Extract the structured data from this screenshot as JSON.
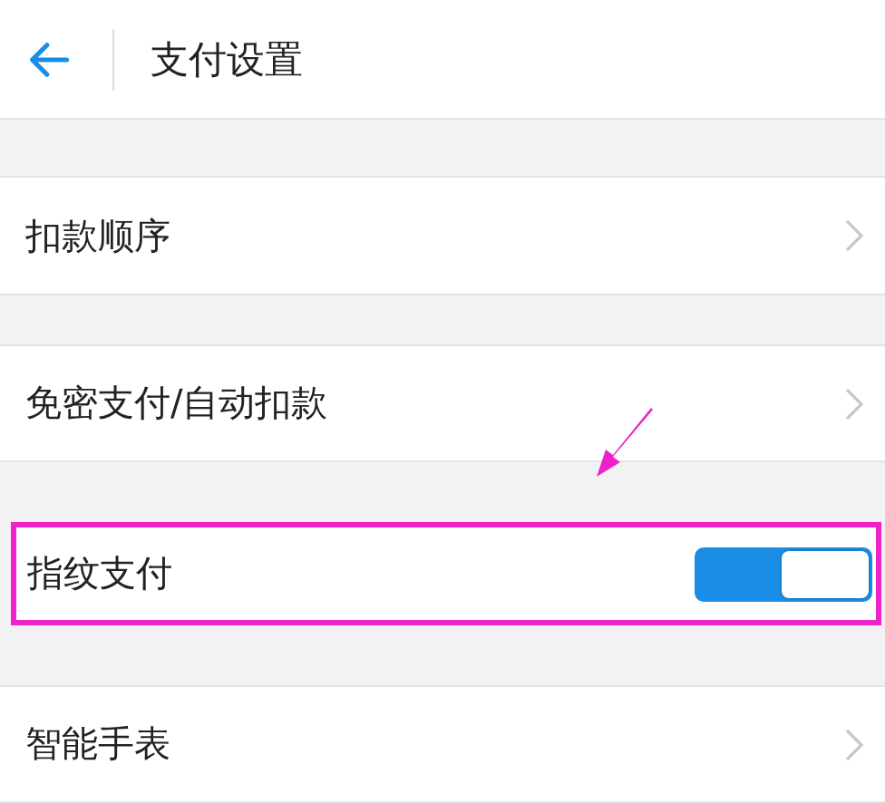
{
  "header": {
    "title": "支付设置"
  },
  "sections": [
    {
      "kind": "link",
      "label": "扣款顺序",
      "highlighted": false
    },
    {
      "kind": "link",
      "label": "免密支付/自动扣款",
      "highlighted": false
    },
    {
      "kind": "toggle",
      "label": "指纹支付",
      "on": true,
      "highlighted": true
    },
    {
      "kind": "link",
      "label": "智能手表",
      "highlighted": false
    }
  ]
}
